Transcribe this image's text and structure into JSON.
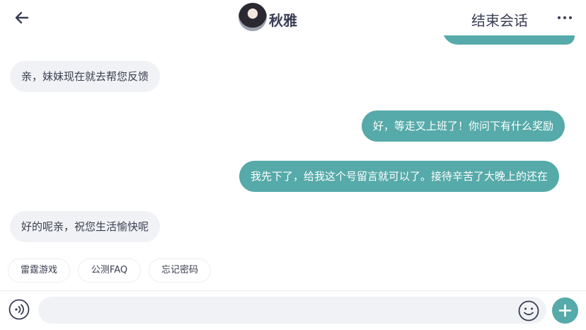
{
  "header": {
    "back_icon": "arrow-left-icon",
    "contact_name": "秋雅",
    "end_session_label": "结束会话",
    "more_icon": "more-horizontal-icon"
  },
  "colors": {
    "accent": "#56aaa9",
    "incoming_bubble": "#f1f2f5",
    "text": "#3b3e50"
  },
  "messages": [
    {
      "direction": "in",
      "text": "亲，妹妹现在就去帮您反馈"
    },
    {
      "direction": "out",
      "text": "好，等走叉上班了！你问下有什么奖励"
    },
    {
      "direction": "out",
      "text": "我先下了，给我这个号留言就可以了。接待辛苦了大晚上的还在"
    },
    {
      "direction": "in",
      "text": "好的呢亲，祝您生活愉快呢"
    }
  ],
  "quick_replies": [
    "雷霆游戏",
    "公测FAQ",
    "忘记密码"
  ],
  "input_bar": {
    "voice_icon": "voice-icon",
    "message_value": "",
    "emoji_icon": "emoji-icon",
    "plus_icon": "plus-icon"
  }
}
